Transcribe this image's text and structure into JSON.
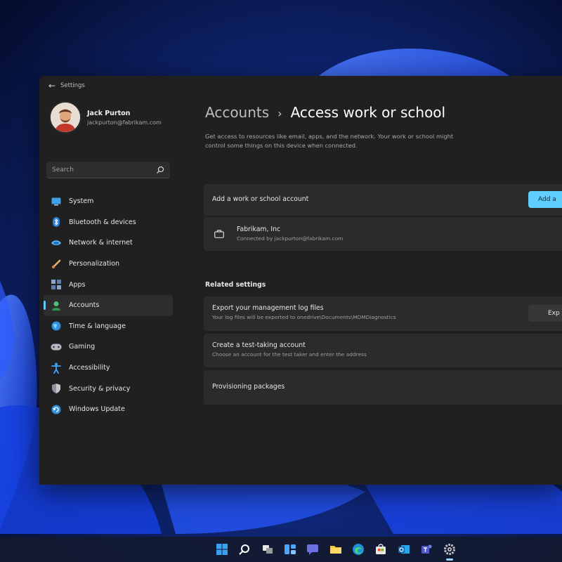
{
  "window": {
    "title": "Settings",
    "back_glyph": "←"
  },
  "profile": {
    "name": "Jack Purton",
    "email": "jackpurton@fabrikam.com"
  },
  "search": {
    "placeholder": "Search"
  },
  "nav": {
    "items": [
      {
        "label": "System",
        "icon": "system-icon"
      },
      {
        "label": "Bluetooth & devices",
        "icon": "bluetooth-icon"
      },
      {
        "label": "Network & internet",
        "icon": "network-icon"
      },
      {
        "label": "Personalization",
        "icon": "brush-icon"
      },
      {
        "label": "Apps",
        "icon": "apps-icon"
      },
      {
        "label": "Accounts",
        "icon": "accounts-icon",
        "active": true
      },
      {
        "label": "Time & language",
        "icon": "globe-icon"
      },
      {
        "label": "Gaming",
        "icon": "gamepad-icon"
      },
      {
        "label": "Accessibility",
        "icon": "accessibility-icon"
      },
      {
        "label": "Security & privacy",
        "icon": "shield-icon"
      },
      {
        "label": "Windows Update",
        "icon": "update-icon"
      }
    ]
  },
  "main": {
    "breadcrumb": {
      "parent": "Accounts",
      "separator": "›",
      "current": "Access work or school"
    },
    "description": "Get access to resources like email, apps, and the network. Your work or school might control some things on this device when connected.",
    "add_account": {
      "label": "Add a work or school account",
      "button": "Add a"
    },
    "account": {
      "org": "Fabrikam, Inc",
      "connected": "Connected by jackpurton@fabrikam.com"
    },
    "related_title": "Related settings",
    "related": [
      {
        "title": "Export your management log files",
        "subtitle": "Your log files will be exported to onedrive\\Documents\\MDMDiagnostics",
        "button": "Exp"
      },
      {
        "title": "Create a test-taking account",
        "subtitle": "Choose an account for the test taker and enter the address"
      },
      {
        "title": "Provisioning packages"
      }
    ]
  },
  "colors": {
    "accent": "#60cdff",
    "window_bg": "#202020",
    "card_bg": "#2b2b2b"
  },
  "taskbar": {
    "icons": [
      "windows-start-icon",
      "search-icon",
      "task-view-icon",
      "widgets-icon",
      "teams-chat-icon",
      "file-explorer-icon",
      "edge-icon",
      "store-icon",
      "outlook-icon",
      "teams-icon",
      "settings-icon"
    ]
  }
}
